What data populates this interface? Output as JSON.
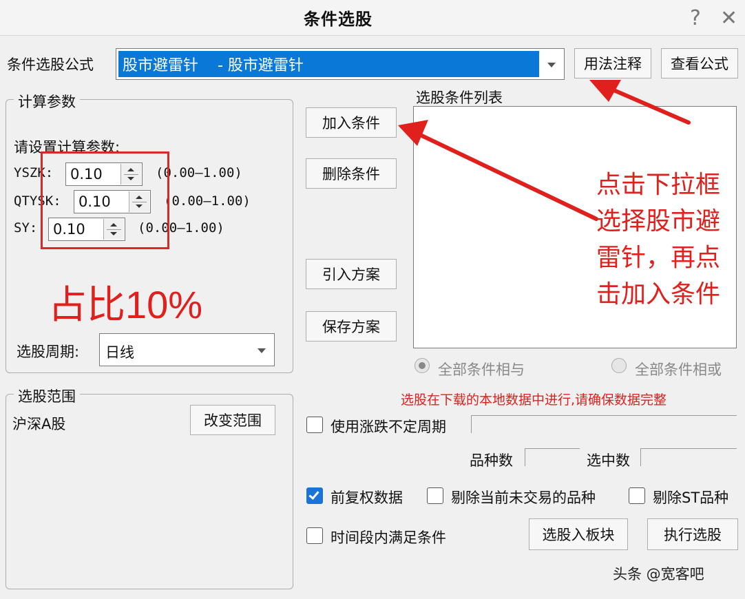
{
  "window": {
    "title": "条件选股",
    "help_glyph": "?",
    "close_glyph": "✕"
  },
  "formula": {
    "label": "条件选股公式",
    "selected": "股市避雷针    - 股市避雷针",
    "usage_button": "用法注释",
    "view_button": "查看公式"
  },
  "params": {
    "group_title": "计算参数",
    "prompt": "请设置计算参数:",
    "rows": [
      {
        "name": "YSZK:",
        "value": "0.10",
        "range": "(0.00—1.00)"
      },
      {
        "name": "QTYSK:",
        "value": "0.10",
        "range": "(0.00—1.00)"
      },
      {
        "name": "SY:",
        "value": "0.10",
        "range": "(0.00—1.00)"
      }
    ],
    "period_label": "选股周期:",
    "period_value": "日线"
  },
  "scope": {
    "group_title": "选股范围",
    "value": "沪深A股",
    "change_button": "改变范围"
  },
  "actions": {
    "add": "加入条件",
    "delete": "删除条件",
    "import": "引入方案",
    "save": "保存方案"
  },
  "conditions": {
    "list_label": "选股条件列表",
    "radio_and": "全部条件相与",
    "radio_or": "全部条件相或"
  },
  "notice": "选股在下载的本地数据中进行,请确保数据完整",
  "options": {
    "use_irregular_period": "使用涨跌不定周期",
    "variety_count_label": "品种数",
    "selected_count_label": "选中数",
    "forward_adjust": "前复权数据",
    "exclude_untraded": "剔除当前未交易的品种",
    "exclude_st": "剔除ST品种",
    "time_range": "时间段内满足条件",
    "to_block_button": "选股入板块",
    "execute_button": "执行选股"
  },
  "annotations": {
    "ratio_note": "占比10%",
    "instruction": [
      "点击下拉框",
      "选择股市避",
      "雷针，再点",
      "击加入条件"
    ],
    "watermark": "头条 @宽客吧"
  },
  "colors": {
    "accent": "#0a78d7",
    "annotation_red": "#e0201c",
    "checkbox_on": "#1a73d9"
  }
}
